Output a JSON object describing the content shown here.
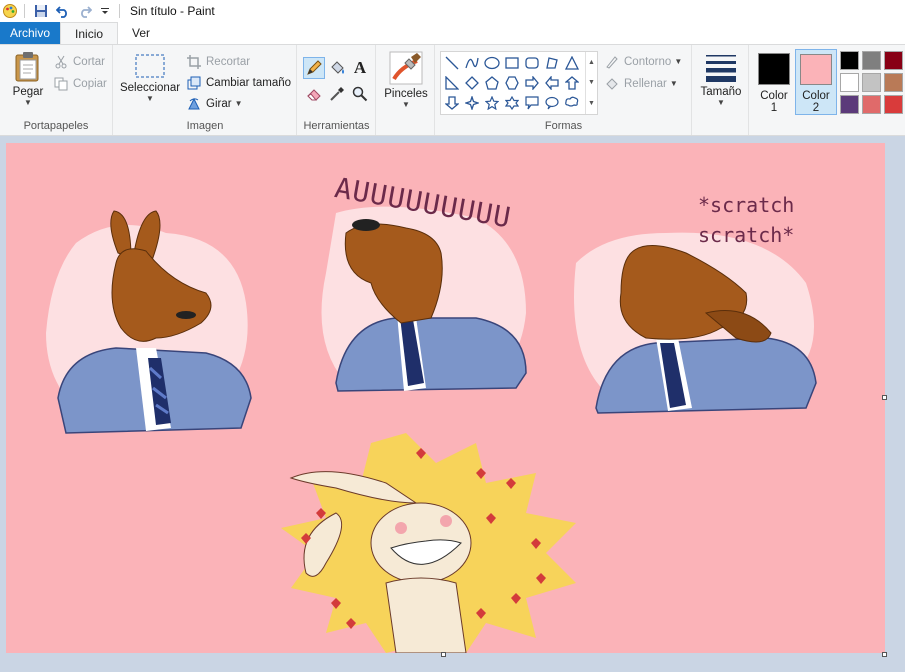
{
  "window": {
    "title": "Sin título - Paint"
  },
  "tabs": {
    "file": "Archivo",
    "home": "Inicio",
    "view": "Ver"
  },
  "clipboard": {
    "paste": "Pegar",
    "cut": "Cortar",
    "copy": "Copiar",
    "label": "Portapapeles"
  },
  "image": {
    "select": "Seleccionar",
    "crop": "Recortar",
    "resize": "Cambiar tamaño",
    "rotate": "Girar",
    "label": "Imagen"
  },
  "tools": {
    "label": "Herramientas"
  },
  "brushes": {
    "label": "Pinceles"
  },
  "shapes": {
    "outline": "Contorno",
    "fill": "Rellenar",
    "label": "Formas"
  },
  "size": {
    "label": "Tamaño"
  },
  "colors": {
    "color1_label": "Color",
    "color1_num": "1",
    "color2_label": "Color",
    "color2_num": "2",
    "color1": "#000000",
    "color2": "#fbb3b8",
    "palette": [
      "#000000",
      "#7f7f7f",
      "#880015",
      "#ffffff",
      "#c3c3c3",
      "#b97a57",
      "#5b3a7a",
      "#e06a6a",
      "#d93b3b"
    ]
  },
  "canvas": {
    "background": "#fbb3b8",
    "text_howl": "AUUUUUUUUU",
    "text_scratch1": "*scratch",
    "text_scratch2": "scratch*"
  }
}
